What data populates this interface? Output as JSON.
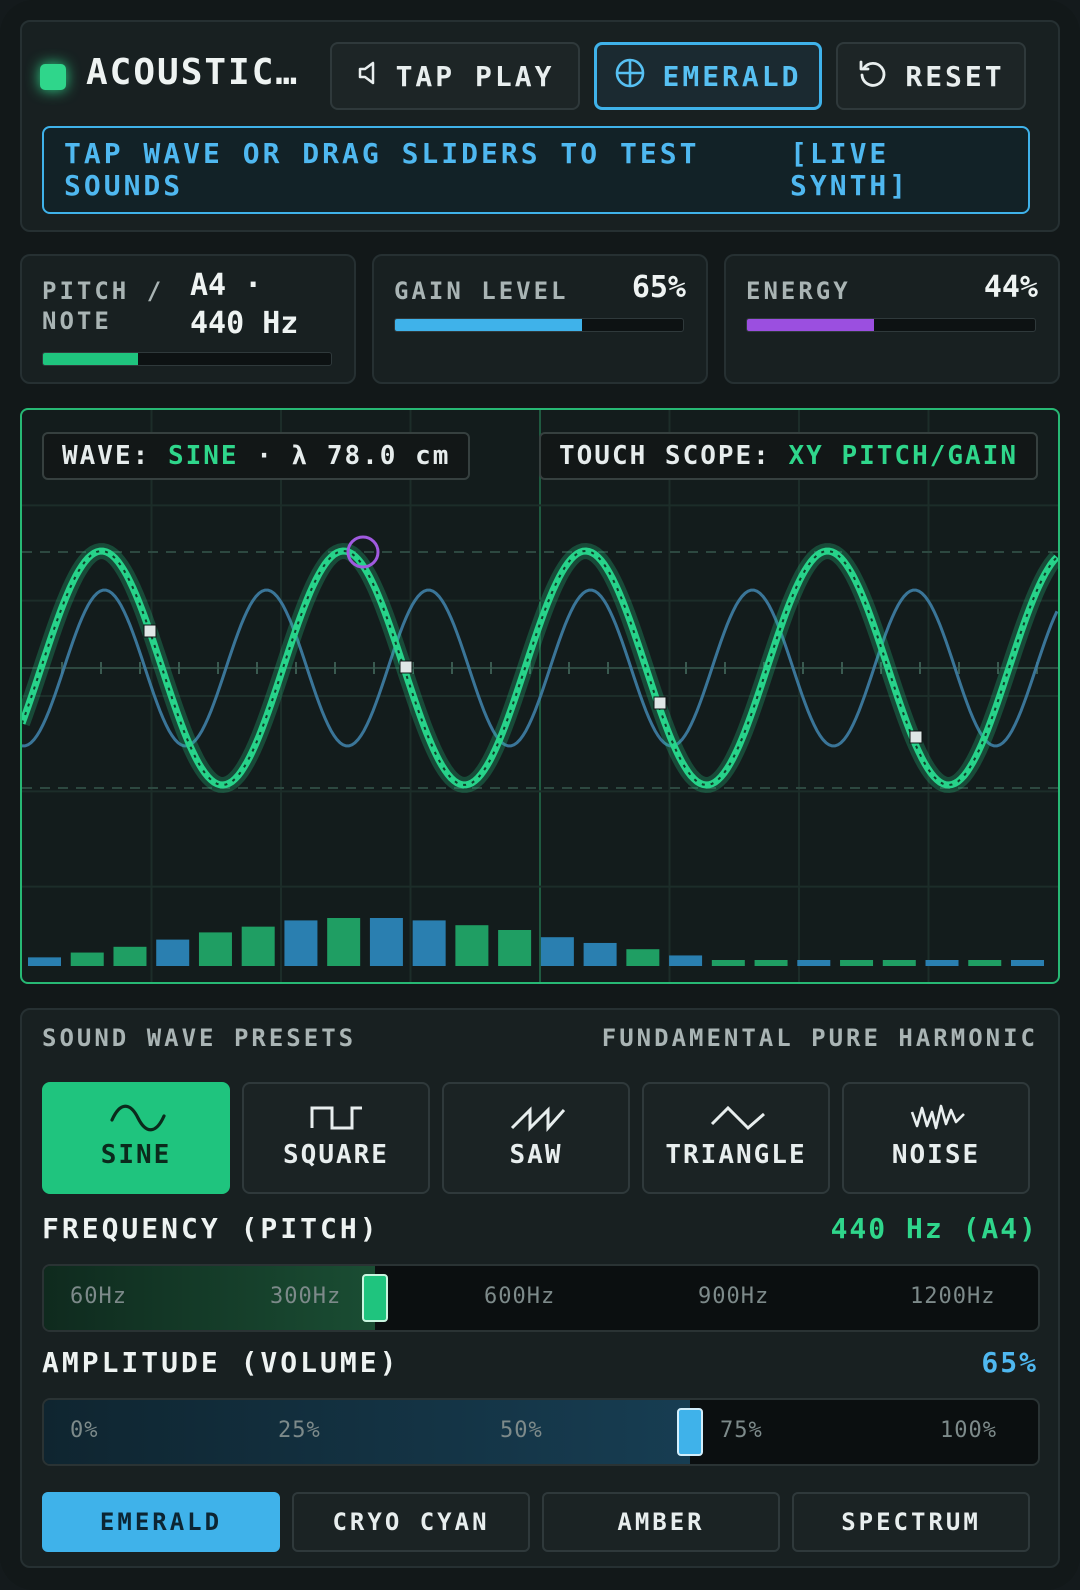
{
  "header": {
    "title": "ACOUSTIC…",
    "tap_play_label": "TAP PLAY",
    "theme_label": "EMERALD",
    "reset_label": "RESET",
    "banner_text": "TAP WAVE OR DRAG SLIDERS TO TEST SOUNDS",
    "banner_tag": "[LIVE SYNTH]",
    "icons": {
      "tap_play": "speaker-icon",
      "theme": "globe-icon",
      "reset": "reset-icon"
    }
  },
  "stats": {
    "pitch": {
      "label": "PITCH / NOTE",
      "value_note": "A4 ·",
      "value_hz": "440 Hz",
      "level": 0.33,
      "color": "#1fc47e"
    },
    "gain": {
      "label": "GAIN LEVEL",
      "value": "65%",
      "level": 0.65,
      "color": "#3fb2ea"
    },
    "energy": {
      "label": "ENERGY",
      "value": "44%",
      "level": 0.44,
      "color": "#9b4fe0"
    }
  },
  "scope": {
    "wave_prefix": "WAVE:",
    "wave_type": "SINE",
    "wavelength": "· λ 78.0 cm",
    "touch_prefix": "TOUCH SCOPE:",
    "touch_mode": "XY PITCH/GAIN",
    "spectrum": [
      0.18,
      0.28,
      0.4,
      0.55,
      0.7,
      0.82,
      0.95,
      1.0,
      1.0,
      0.95,
      0.85,
      0.75,
      0.6,
      0.48,
      0.35,
      0.22,
      0.12,
      0.12,
      0.12,
      0.12,
      0.12,
      0.12,
      0.12,
      0.12
    ],
    "colors": {
      "primary": "#27d38a",
      "secondary": "#3f7fa6",
      "marker": "#a05adf"
    }
  },
  "presets": {
    "title": "SOUND WAVE PRESETS",
    "subtitle": "FUNDAMENTAL PURE HARMONIC",
    "waves": [
      {
        "label": "SINE",
        "icon": "sine-wave-icon",
        "active": true
      },
      {
        "label": "SQUARE",
        "icon": "square-wave-icon",
        "active": false
      },
      {
        "label": "SAW",
        "icon": "saw-wave-icon",
        "active": false
      },
      {
        "label": "TRIANGLE",
        "icon": "triangle-wave-icon",
        "active": false
      },
      {
        "label": "NOISE",
        "icon": "noise-wave-icon",
        "active": false
      }
    ],
    "frequency": {
      "title": "FREQUENCY (PITCH)",
      "value": "440 Hz (A4)",
      "ticks": [
        "60Hz",
        "300Hz",
        "600Hz",
        "900Hz",
        "1200Hz"
      ],
      "level": 0.333
    },
    "amplitude": {
      "title": "AMPLITUDE (VOLUME)",
      "value": "65%",
      "ticks": [
        "0%",
        "25%",
        "50%",
        "75%",
        "100%"
      ],
      "level": 0.65
    },
    "themes": [
      {
        "label": "EMERALD",
        "active": true
      },
      {
        "label": "CRYO CYAN",
        "active": false
      },
      {
        "label": "AMBER",
        "active": false
      },
      {
        "label": "SPECTRUM",
        "active": false
      }
    ]
  }
}
